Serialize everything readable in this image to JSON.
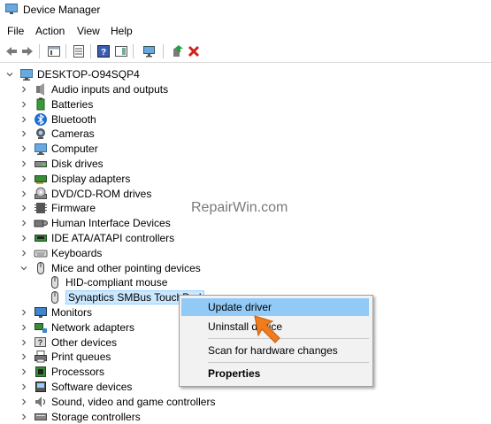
{
  "window": {
    "title": "Device Manager"
  },
  "menu": [
    "File",
    "Action",
    "View",
    "Help"
  ],
  "toolbar": {
    "buttons": [
      "back-icon",
      "forward-icon",
      "properties-icon",
      "show-hide-icon",
      "help-icon",
      "action-pane-icon",
      "scan-hardware-icon",
      "update-driver-icon",
      "uninstall-icon"
    ]
  },
  "tree": {
    "root": "DESKTOP-O94SQP4",
    "categories": [
      {
        "label": "Audio inputs and outputs",
        "icon": "speaker-icon"
      },
      {
        "label": "Batteries",
        "icon": "battery-icon"
      },
      {
        "label": "Bluetooth",
        "icon": "bluetooth-icon"
      },
      {
        "label": "Cameras",
        "icon": "camera-icon"
      },
      {
        "label": "Computer",
        "icon": "computer-icon"
      },
      {
        "label": "Disk drives",
        "icon": "disk-drive-icon"
      },
      {
        "label": "Display adapters",
        "icon": "display-adapter-icon"
      },
      {
        "label": "DVD/CD-ROM drives",
        "icon": "dvd-drive-icon"
      },
      {
        "label": "Firmware",
        "icon": "firmware-icon"
      },
      {
        "label": "Human Interface Devices",
        "icon": "hid-icon"
      },
      {
        "label": "IDE ATA/ATAPI controllers",
        "icon": "ide-controller-icon"
      },
      {
        "label": "Keyboards",
        "icon": "keyboard-icon"
      },
      {
        "label": "Mice and other pointing devices",
        "icon": "mouse-icon",
        "expanded": true
      },
      {
        "label": "Monitors",
        "icon": "monitor-icon"
      },
      {
        "label": "Network adapters",
        "icon": "network-adapter-icon"
      },
      {
        "label": "Other devices",
        "icon": "other-devices-icon"
      },
      {
        "label": "Print queues",
        "icon": "printer-icon"
      },
      {
        "label": "Processors",
        "icon": "processor-icon"
      },
      {
        "label": "Software devices",
        "icon": "software-device-icon"
      },
      {
        "label": "Sound, video and game controllers",
        "icon": "sound-icon"
      },
      {
        "label": "Storage controllers",
        "icon": "storage-controller-icon"
      }
    ],
    "mice_children": [
      "HID-compliant mouse",
      "Synaptics SMBus TouchPad"
    ]
  },
  "watermark": "RepairWin.com",
  "context_menu": {
    "items": [
      "Update driver",
      "Uninstall device",
      "Scan for hardware changes",
      "Properties"
    ],
    "highlighted": "Update driver"
  },
  "colors": {
    "highlight": "#91c9f7",
    "selection": "#cce8ff",
    "cursor": "#f07c1e"
  }
}
